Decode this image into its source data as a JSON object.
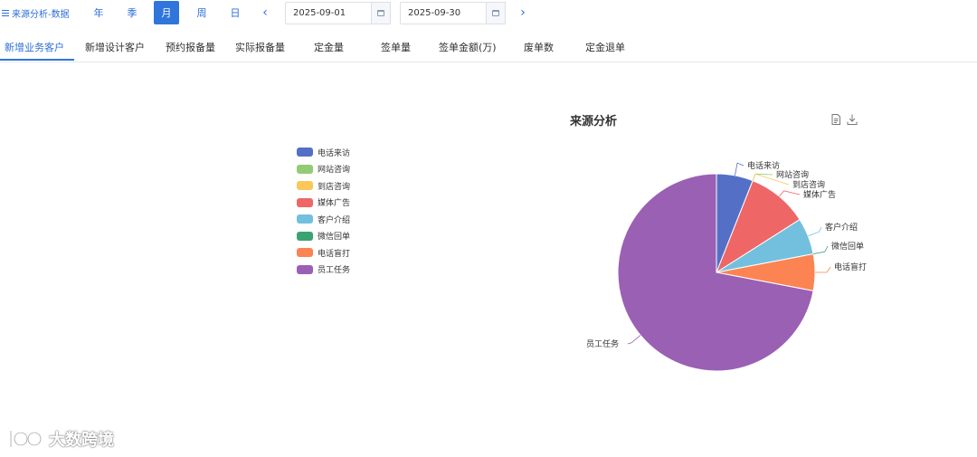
{
  "header": {
    "title": "来源分析-数据",
    "period_buttons": [
      {
        "label": "年",
        "active": false
      },
      {
        "label": "季",
        "active": false
      },
      {
        "label": "月",
        "active": true
      },
      {
        "label": "周",
        "active": false
      },
      {
        "label": "日",
        "active": false
      }
    ],
    "start_date": "2025-09-01",
    "end_date": "2025-09-30",
    "prev_icon": "chevron-left-icon",
    "next_icon": "chevron-right-icon",
    "accent_color": "#2f75dc"
  },
  "tabs": [
    {
      "label": "新增业务客户",
      "active": true
    },
    {
      "label": "新增设计客户",
      "active": false
    },
    {
      "label": "预约报备量",
      "active": false
    },
    {
      "label": "实际报备量",
      "active": false
    },
    {
      "label": "定金量",
      "active": false
    },
    {
      "label": "签单量",
      "active": false
    },
    {
      "label": "签单金额(万)",
      "active": false
    },
    {
      "label": "废单数",
      "active": false
    },
    {
      "label": "定金退单",
      "active": false
    }
  ],
  "chart": {
    "title": "来源分析",
    "toolbox": [
      "data-view-icon",
      "download-icon"
    ]
  },
  "chart_data": {
    "type": "pie",
    "title": "来源分析",
    "legend_position": "left",
    "categories": [
      "电话来访",
      "网站咨询",
      "到店咨询",
      "媒体广告",
      "客户介绍",
      "微信回单",
      "电话盲打",
      "员工任务"
    ],
    "values": [
      6,
      0,
      0,
      10,
      6,
      0,
      6,
      72
    ],
    "colors": [
      "#5470c6",
      "#91cc75",
      "#fac858",
      "#ee6666",
      "#73c0de",
      "#3ba272",
      "#fc8452",
      "#9a60b4"
    ]
  },
  "watermark": {
    "text": "大数跨境"
  }
}
